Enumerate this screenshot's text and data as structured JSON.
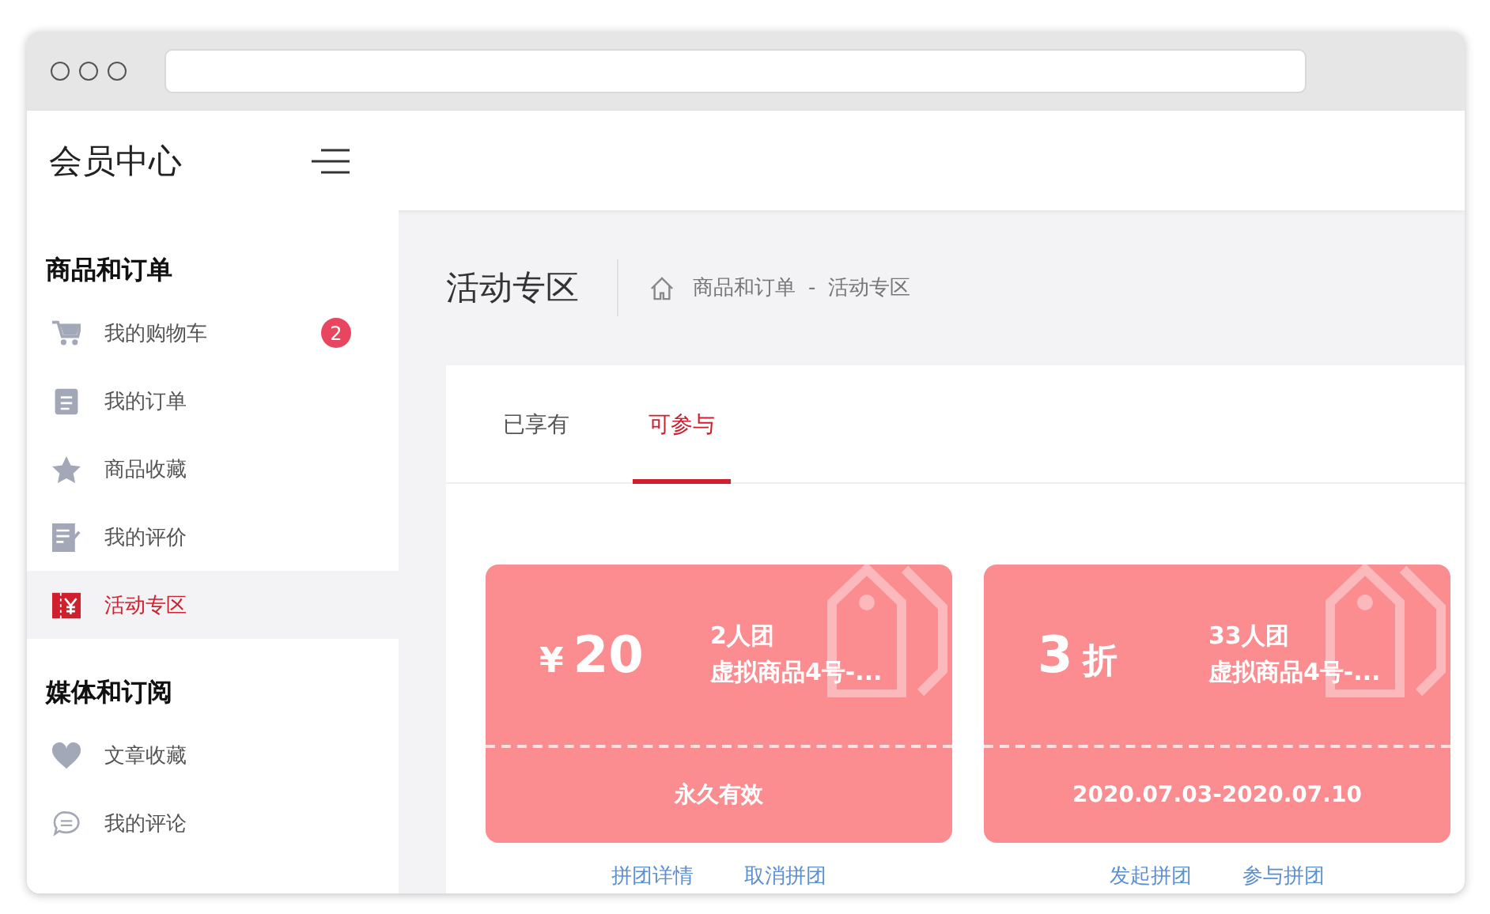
{
  "header": {
    "title": "会员中心"
  },
  "sidebar": {
    "groups": [
      {
        "title": "商品和订单",
        "items": [
          {
            "label": "我的购物车",
            "badge": "2",
            "selected": false
          },
          {
            "label": "我的订单",
            "selected": false
          },
          {
            "label": "商品收藏",
            "selected": false
          },
          {
            "label": "我的评价",
            "selected": false
          },
          {
            "label": "活动专区",
            "selected": true
          }
        ]
      },
      {
        "title": "媒体和订阅",
        "items": [
          {
            "label": "文章收藏",
            "selected": false
          },
          {
            "label": "我的评论",
            "selected": false
          }
        ]
      }
    ]
  },
  "page": {
    "title": "活动专区",
    "breadcrumb": [
      "商品和订单",
      "活动专区"
    ],
    "breadcrumb_separator": "-"
  },
  "tabs": [
    {
      "label": "已享有",
      "selected": false
    },
    {
      "label": "可参与",
      "selected": true
    }
  ],
  "cards": [
    {
      "prefix": "¥",
      "value": "20",
      "group": "2人团",
      "product": "虚拟商品4号-...",
      "validity": "永久有效",
      "links": [
        "拼团详情",
        "取消拼团"
      ]
    },
    {
      "value": "3",
      "suffix": "折",
      "group": "33人团",
      "product": "虚拟商品4号-...",
      "validity": "2020.07.03-2020.07.10",
      "links": [
        "发起拼团",
        "参与拼团"
      ]
    }
  ]
}
